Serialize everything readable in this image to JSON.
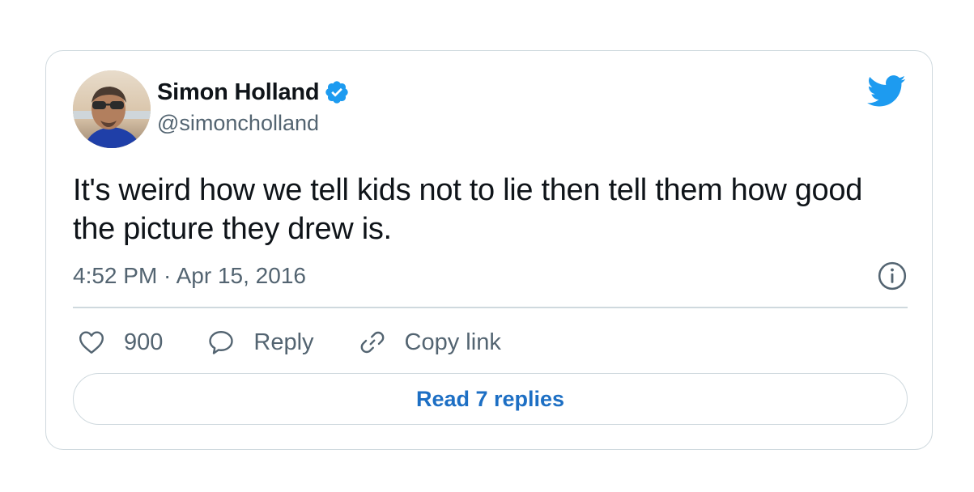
{
  "author": {
    "name": "Simon Holland",
    "handle": "@simoncholland",
    "verified": true
  },
  "tweet": {
    "text": "It's weird how we tell kids not to lie then tell them how good the picture they drew is.",
    "timestamp": "4:52 PM · Apr 15, 2016"
  },
  "actions": {
    "likes": "900",
    "reply_label": "Reply",
    "copy_label": "Copy link"
  },
  "read_replies_label": "Read 7 replies",
  "icons": {
    "verified": "verified-badge-icon",
    "brand": "twitter-bird-icon",
    "info": "info-icon",
    "like": "heart-icon",
    "reply": "speech-bubble-icon",
    "copy": "link-icon"
  },
  "colors": {
    "brand": "#1d9bf0",
    "text": "#0f1419",
    "muted": "#536471",
    "border": "#cfd9de",
    "link": "#1d6fc4"
  }
}
